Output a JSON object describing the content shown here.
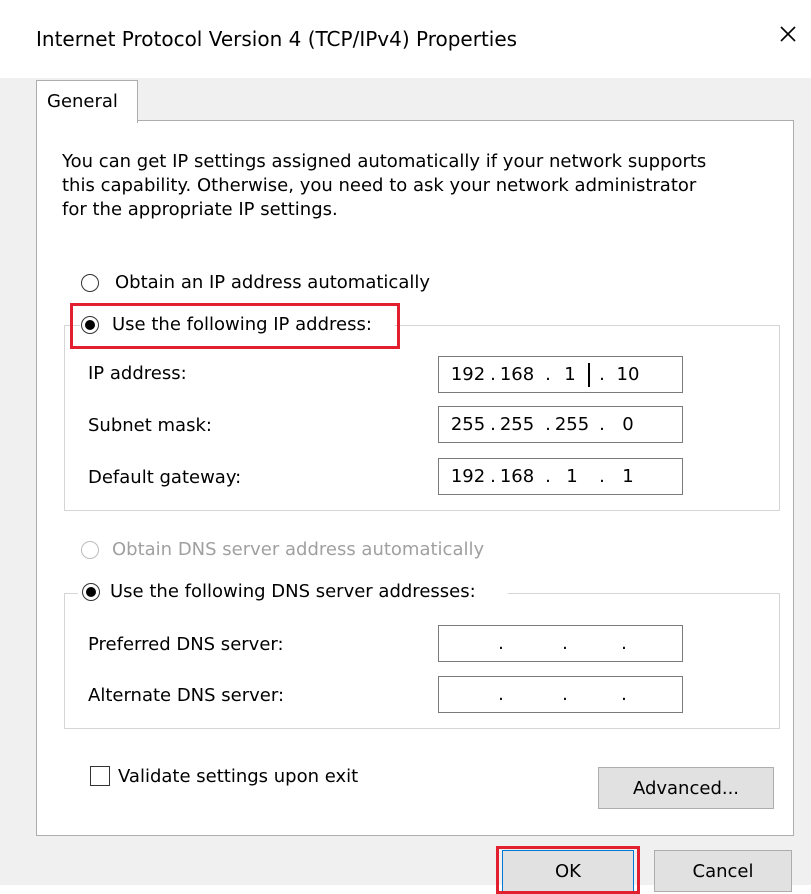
{
  "window": {
    "title": "Internet Protocol Version 4 (TCP/IPv4) Properties",
    "close_icon": "close-icon"
  },
  "tabs": [
    {
      "label": "General",
      "selected": true
    }
  ],
  "general": {
    "intro": "You can get IP settings assigned automatically if your network supports\nthis capability. Otherwise, you need to ask your network administrator\nfor the appropriate IP settings.",
    "ip_section": {
      "auto_label": "Obtain an IP address automatically",
      "manual_label": "Use the following IP address:",
      "selected": "manual",
      "fields": {
        "ip_address": {
          "label": "IP address:",
          "octets": [
            "192",
            "168",
            "1",
            "10"
          ]
        },
        "subnet_mask": {
          "label": "Subnet mask:",
          "octets": [
            "255",
            "255",
            "255",
            "0"
          ]
        },
        "default_gateway": {
          "label": "Default gateway:",
          "octets": [
            "192",
            "168",
            "1",
            "1"
          ]
        }
      }
    },
    "dns_section": {
      "auto_label": "Obtain DNS server address automatically",
      "auto_enabled": false,
      "manual_label": "Use the following DNS server addresses:",
      "selected": "manual",
      "fields": {
        "preferred": {
          "label": "Preferred DNS server:",
          "octets": [
            "",
            "",
            "",
            ""
          ]
        },
        "alternate": {
          "label": "Alternate DNS server:",
          "octets": [
            "",
            "",
            "",
            ""
          ]
        }
      }
    },
    "validate_label": "Validate settings upon exit",
    "validate_checked": false,
    "advanced_label": "Advanced..."
  },
  "buttons": {
    "ok": "OK",
    "cancel": "Cancel"
  },
  "colors": {
    "highlight": "#e21f2f",
    "window_bg": "#f0f0f0",
    "panel_bg": "#ffffff"
  }
}
